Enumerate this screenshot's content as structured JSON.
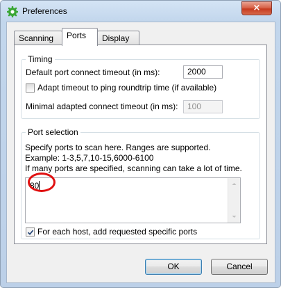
{
  "window": {
    "title": "Preferences",
    "close_label": "×"
  },
  "tabs": [
    {
      "label": "Scanning",
      "active": false
    },
    {
      "label": "Ports",
      "active": true
    },
    {
      "label": "Display",
      "active": false
    }
  ],
  "timing": {
    "legend": "Timing",
    "connect_timeout_label": "Default port connect timeout (in ms):",
    "connect_timeout_value": "2000",
    "adapt_label": "Adapt timeout to ping roundtrip time (if available)",
    "adapt_checked": false,
    "min_adapted_label": "Minimal adapted connect timeout (in ms):",
    "min_adapted_value": "100"
  },
  "port_selection": {
    "legend": "Port selection",
    "desc_line1": "Specify ports to scan here. Ranges are supported.",
    "desc_line2": "Example: 1-3,5,7,10-15,6000-6100",
    "desc_line3": "If many ports are specified, scanning can take a lot of time.",
    "ports_value": "80",
    "add_requested_label": "For each host, add requested specific ports",
    "add_requested_checked": true
  },
  "buttons": {
    "ok": "OK",
    "cancel": "Cancel"
  },
  "colors": {
    "annotation": "#e01010",
    "app_icon": "#3aa635"
  },
  "icons": {
    "app": "gear-icon",
    "close": "close-icon",
    "checkmark": "checkmark-icon",
    "scroll_up": "arrow-up-icon",
    "scroll_down": "arrow-down-icon"
  }
}
